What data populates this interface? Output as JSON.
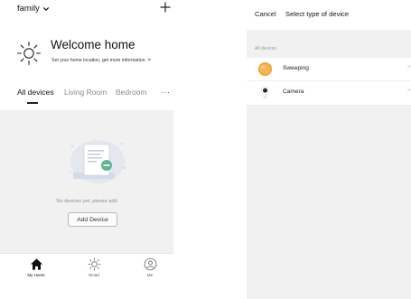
{
  "home": {
    "family_label": "family",
    "welcome_title": "Welcome home",
    "welcome_subtitle": "Set your home location, get more information",
    "welcome_arrow": ">",
    "tabs": [
      {
        "label": "All devices"
      },
      {
        "label": "Living Room"
      },
      {
        "label": "Bedroom"
      }
    ],
    "more_label": "···",
    "empty_text": "No devices yet, please add",
    "add_button_label": "Add Device",
    "nav": [
      {
        "label": "My Home",
        "icon": "home-icon"
      },
      {
        "label": "Smart",
        "icon": "sun-icon"
      },
      {
        "label": "Me",
        "icon": "user-icon"
      }
    ]
  },
  "device_picker": {
    "cancel_label": "Cancel",
    "title": "Select type of device",
    "section_label": "All devices",
    "devices": [
      {
        "name": "Sweeping",
        "icon": "sweeper-icon"
      },
      {
        "name": "Camera",
        "icon": "camera-icon"
      }
    ],
    "row_arrow": ">"
  },
  "colors": {
    "page_bg": "#f1f1f1",
    "accent_green": "#5fb58f",
    "sweeper_orange": "#f2a33a"
  }
}
